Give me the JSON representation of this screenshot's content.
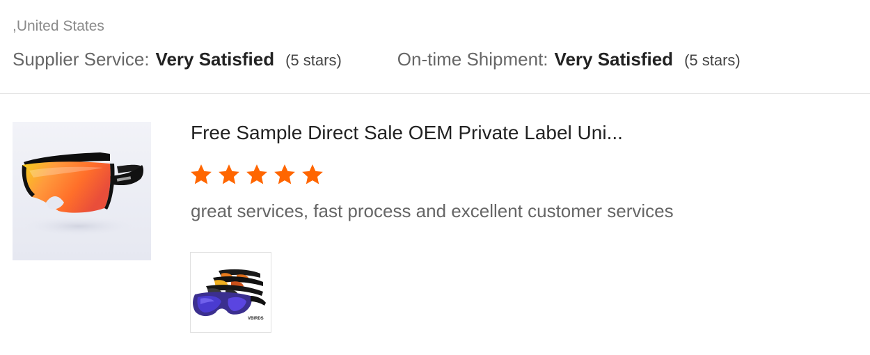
{
  "header": {
    "location": ",United States",
    "ratings": [
      {
        "label": "Supplier Service:",
        "value": "Very Satisfied",
        "stars": "(5 stars)"
      },
      {
        "label": "On-time Shipment:",
        "value": "Very Satisfied",
        "stars": "(5 stars)"
      }
    ]
  },
  "review": {
    "product_title": "Free Sample Direct Sale OEM Private Label Uni...",
    "rating": 5,
    "rating_max": 5,
    "comment": "great services, fast process and excellent customer services",
    "product_image": "sunglasses-product-image",
    "attached_photo": "sunglasses-set-photo",
    "photo_watermark": "VBIRDS"
  },
  "colors": {
    "star": "#ff6600",
    "lens": "#ff7a1a",
    "divider": "#e3e3e3"
  }
}
